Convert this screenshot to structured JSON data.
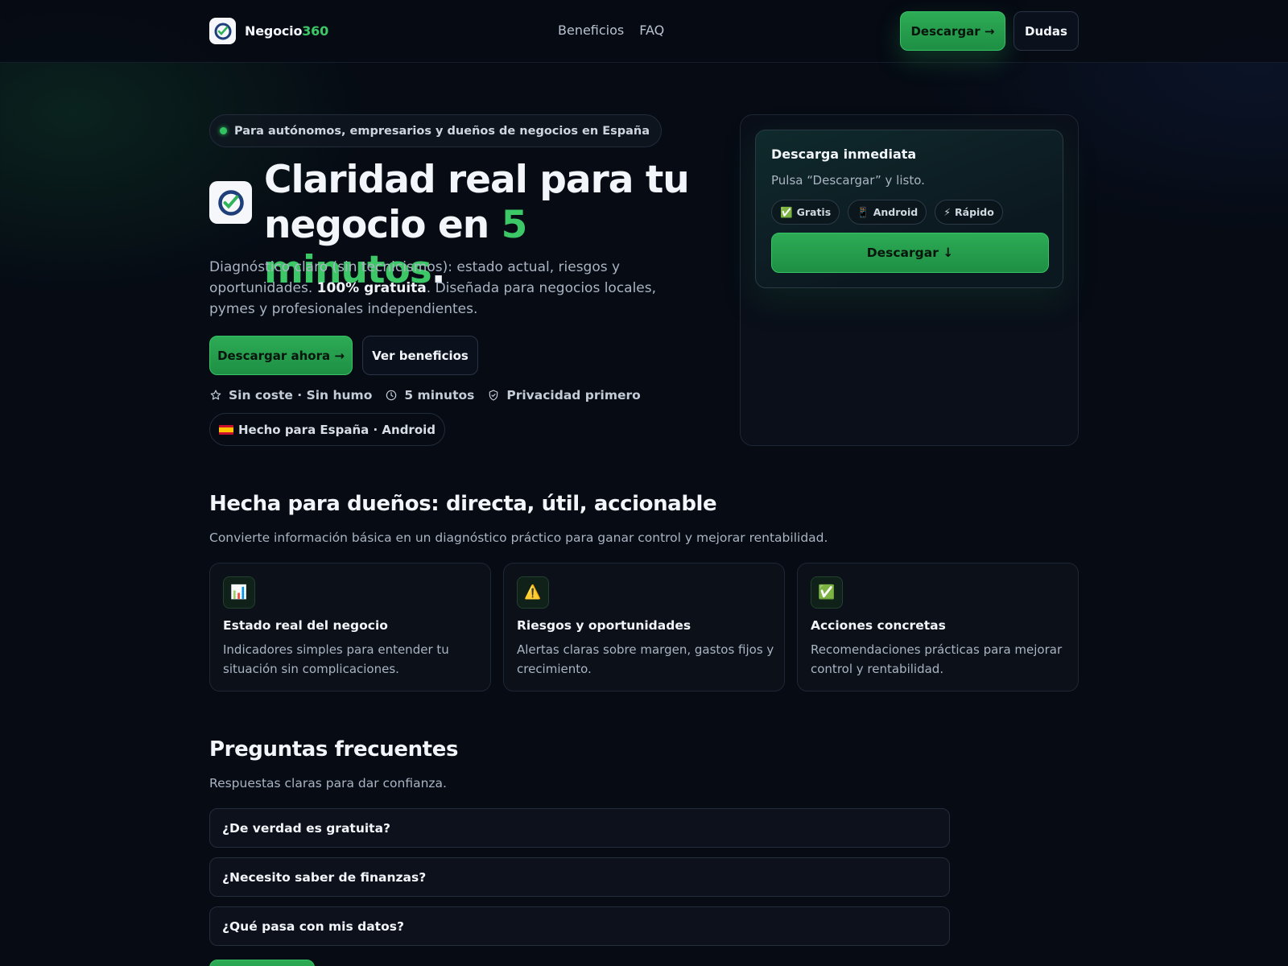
{
  "header": {
    "brand_main": "Negocio",
    "brand_accent": "360",
    "nav": [
      "Beneficios",
      "FAQ"
    ],
    "download_label": "Descargar →",
    "dudas_label": "Dudas"
  },
  "hero": {
    "eyebrow": "Para autónomos, empresarios y dueños de negocios en España",
    "title_line1": "Claridad real para tu",
    "title_line2_pre": "negocio en ",
    "title_accent": "5 minutos",
    "title_end": ".",
    "lead_1": "Diagnóstico claro (sin tecnicismos): estado actual, riesgos y oportunidades. ",
    "lead_bold": "100% gratuita",
    "lead_2": ". Diseñada para negocios locales, pymes y profesionales independientes.",
    "cta_primary": "Descargar ahora →",
    "cta_secondary": "Ver beneficios",
    "features": [
      {
        "icon": "star-icon",
        "text": "Sin coste · Sin humo"
      },
      {
        "icon": "clock-icon",
        "text": "5 minutos"
      },
      {
        "icon": "shield-icon",
        "text": "Privacidad primero"
      }
    ],
    "spain_badge": "Hecho para España · Android"
  },
  "download_card": {
    "title": "Descarga inmediata",
    "subtitle": "Pulsa “Descargar” y listo.",
    "chips": [
      {
        "icon": "✅",
        "label": "Gratis"
      },
      {
        "icon": "📱",
        "label": "Android"
      },
      {
        "icon": "⚡",
        "label": "Rápido"
      }
    ],
    "button": "Descargar ↓"
  },
  "benefits": {
    "title": "Hecha para dueños: directa, útil, accionable",
    "subtitle": "Convierte información básica en un diagnóstico práctico para ganar control y mejorar rentabilidad.",
    "cards": [
      {
        "icon": "📊",
        "title": "Estado real del negocio",
        "desc": "Indicadores simples para entender tu situación sin complicaciones."
      },
      {
        "icon": "⚠️",
        "title": "Riesgos y oportunidades",
        "desc": "Alertas claras sobre margen, gastos fijos y crecimiento."
      },
      {
        "icon": "✅",
        "title": "Acciones concretas",
        "desc": "Recomendaciones prácticas para mejorar control y rentabilidad."
      }
    ]
  },
  "faq": {
    "title": "Preguntas frecuentes",
    "subtitle": "Respuestas claras para dar confianza.",
    "items": [
      "¿De verdad es gratuita?",
      "¿Necesito saber de finanzas?",
      "¿Qué pasa con mis datos?"
    ]
  },
  "colors": {
    "accent": "#3cc866",
    "background": "#060b14"
  }
}
